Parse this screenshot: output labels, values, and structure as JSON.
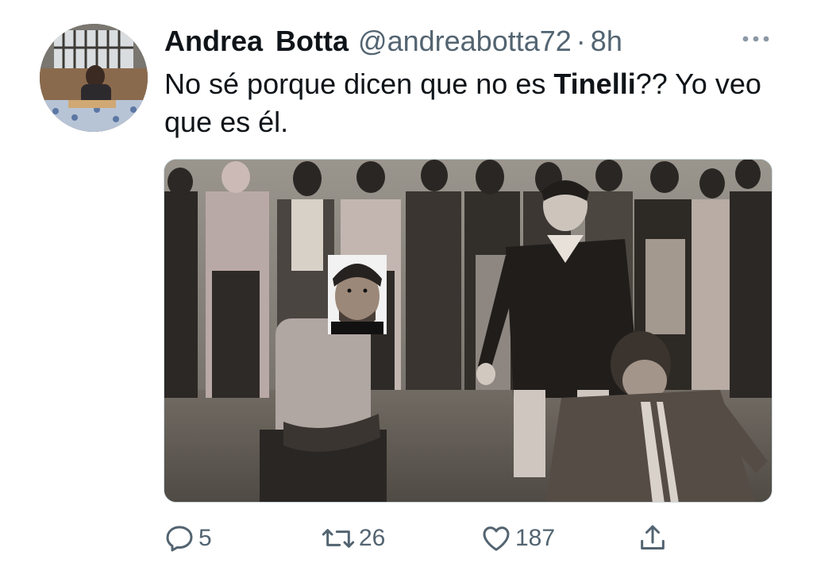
{
  "tweet": {
    "author": {
      "display_name": "Andrea  Botta",
      "handle": "@andreabotta72",
      "separator": "·",
      "time": "8h"
    },
    "text": {
      "part1": "No sé porque dicen que no es ",
      "bold": "Tinelli",
      "part2": "?? Yo veo que es él."
    },
    "actions": {
      "reply_count": "5",
      "retweet_count": "26",
      "like_count": "187"
    },
    "icons": {
      "more": "more-horizontal-icon",
      "reply": "reply-icon",
      "retweet": "retweet-icon",
      "like": "like-icon",
      "share": "share-icon"
    },
    "colors": {
      "text_primary": "#0f1419",
      "text_secondary": "#536471"
    }
  }
}
